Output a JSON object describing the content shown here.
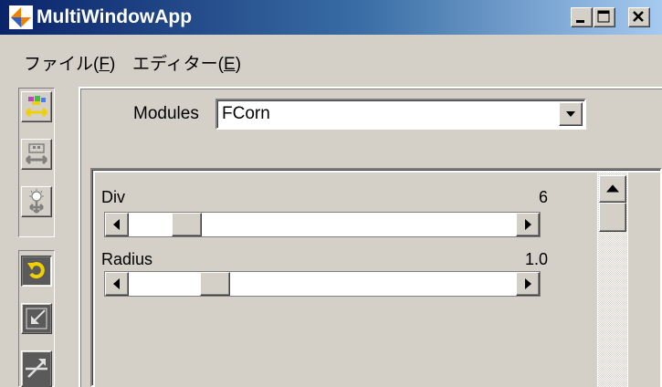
{
  "window": {
    "title": "MultiWindowApp"
  },
  "menu": [
    {
      "label": "ファイル(",
      "key": "F",
      "close": ")"
    },
    {
      "label": "エディター(",
      "key": "E",
      "close": ")"
    }
  ],
  "toolbar": {
    "group1": [
      "module-move-colored-icon",
      "module-move-gray-icon",
      "light-move-icon"
    ],
    "group2": [
      "rotate-icon",
      "shrink-icon",
      "expand-icon"
    ]
  },
  "modules": {
    "label": "Modules",
    "value": "FCorn"
  },
  "params": [
    {
      "name": "Div",
      "value": "6",
      "slider_fraction": 0.12
    },
    {
      "name": "Radius",
      "value": "1.0",
      "slider_fraction": 0.2
    }
  ],
  "colors": {
    "title_gradient_start": "#0a246a",
    "title_gradient_end": "#a6caf0",
    "face": "#d4d0c8",
    "rotate_active": "#f0d000"
  }
}
